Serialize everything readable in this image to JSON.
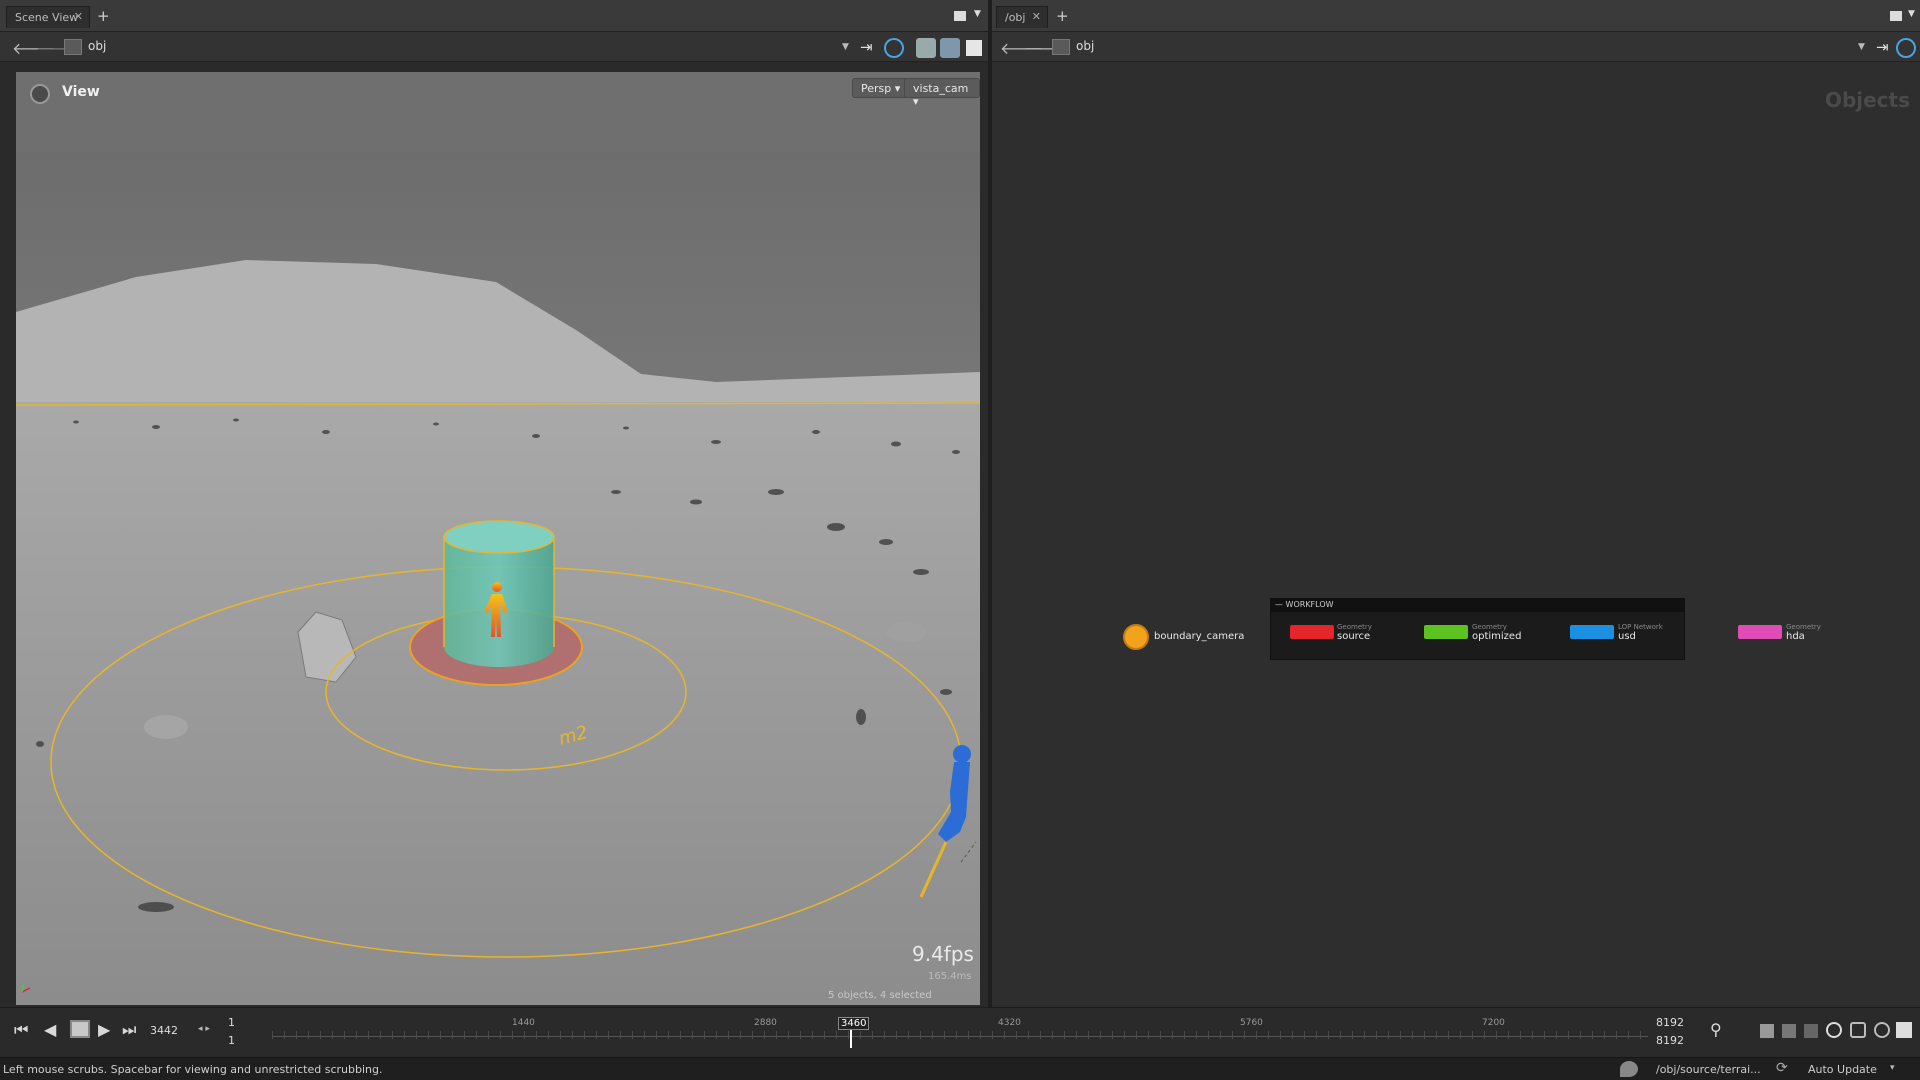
{
  "left_pane": {
    "tab_label": "Scene View",
    "path": "obj",
    "view_label": "View",
    "persp_label": "Persp",
    "camera_label": "vista_cam",
    "fps": "9.4fps",
    "fps_sub": "165.4ms",
    "selection_info": "5 objects, 4 selected",
    "ring_label": "m2"
  },
  "right_pane": {
    "tab_label": "/obj",
    "path": "obj",
    "context_label": "Objects",
    "netbox_title": "WORKFLOW",
    "nodes": [
      {
        "type": "",
        "name": "boundary_camera",
        "color": "#f2a21b"
      },
      {
        "type": "Geometry",
        "name": "source",
        "color": "#e3262a"
      },
      {
        "type": "Geometry",
        "name": "optimized",
        "color": "#5cc21f"
      },
      {
        "type": "LOP Network",
        "name": "usd",
        "color": "#1b8fe0"
      },
      {
        "type": "Geometry",
        "name": "hda",
        "color": "#e04cb5"
      }
    ]
  },
  "timeline": {
    "current_frame": "3442",
    "start_frame": "1",
    "start_frame_2": "1",
    "end_frame": "8192",
    "end_frame_2": "8192",
    "ticks": [
      "1440",
      "2880",
      "3460",
      "4320",
      "5760",
      "7200"
    ],
    "auto_update": "Auto Update",
    "path_display": "/obj/source/terrai..."
  },
  "status": {
    "message": "Left mouse scrubs. Spacebar for viewing and unrestricted scrubbing."
  },
  "colors": {
    "accent_yellow": "#e8b52a",
    "panel_bg": "#2e2e2e",
    "viewport_gray": "#8f8f8f"
  }
}
